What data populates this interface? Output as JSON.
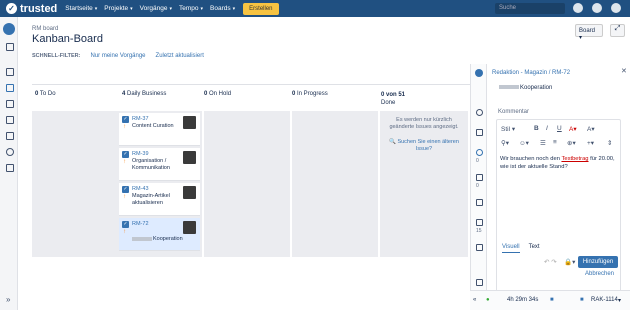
{
  "brand": "trusted",
  "nav": [
    {
      "label": "Startseite"
    },
    {
      "label": "Projekte"
    },
    {
      "label": "Vorgänge"
    },
    {
      "label": "Tempo"
    },
    {
      "label": "Boards"
    }
  ],
  "create_label": "Erstellen",
  "search_placeholder": "Suche",
  "breadcrumb": "RM board",
  "page_title": "Kanban-Board",
  "board_button": "Board",
  "quickfilter": {
    "label": "SCHNELL-FILTER:",
    "items": [
      "Nur meine Vorgänge",
      "Zuletzt aktualisiert"
    ]
  },
  "columns": [
    {
      "count": "0",
      "name": "To Do"
    },
    {
      "count": "4",
      "name": "Daily Business"
    },
    {
      "count": "0",
      "name": "On Hold"
    },
    {
      "count": "0",
      "name": "In Progress"
    },
    {
      "count": "0 von 51",
      "name": "Done"
    }
  ],
  "cards": [
    {
      "key": "RM-37",
      "summary": "Content Curation"
    },
    {
      "key": "RM-39",
      "summary": "Organisation / Kommunikation"
    },
    {
      "key": "RM-43",
      "summary": "Magazin-Artikel aktualisieren"
    },
    {
      "key": "RM-72",
      "summary": "Kooperation"
    }
  ],
  "done_message": "Es werden nur kürzlich geänderte Issues angezeigt.",
  "done_link": "Suchen Sie einen älteren Issue?",
  "panel": {
    "title": "Redaktion - Magazin / RM-72",
    "desc": "Kooperation",
    "rail_counts": [
      "0",
      "0",
      "15"
    ],
    "comment_label": "Kommentar",
    "style_label": "Stil",
    "comment_before": "Wir brauchen noch den ",
    "comment_link": "Testbetrag",
    "comment_after": " für 20.00, wie ist der aktuelle Stand?",
    "tab_visual": "Visuell",
    "tab_text": "Text",
    "add_label": "Hinzufügen",
    "cancel_label": "Abbrechen"
  },
  "footer": {
    "timer": "4h 29m 34s",
    "issue": "RAK-1114"
  }
}
